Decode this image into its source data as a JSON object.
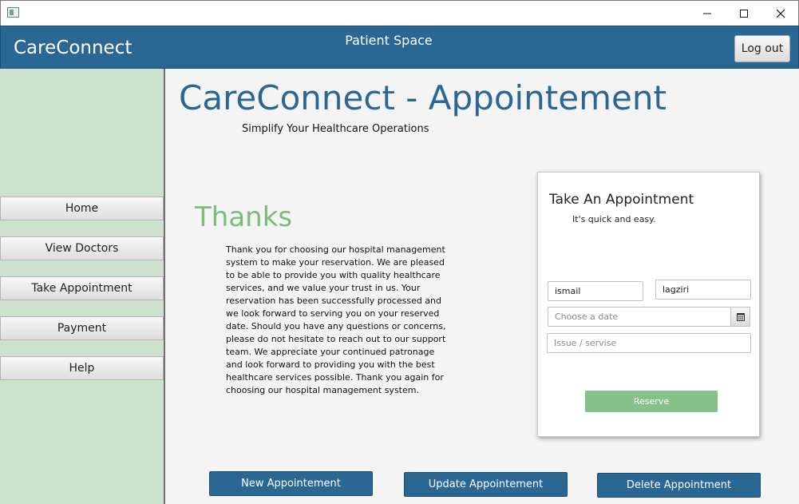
{
  "window": {
    "controls": {
      "minimize": "minimize-icon",
      "maximize": "maximize-icon",
      "close": "close-icon"
    }
  },
  "header": {
    "brand": "CareConnect",
    "space_title": "Patient Space",
    "logout_label": "Log out"
  },
  "sidebar": {
    "items": [
      {
        "label": "Home"
      },
      {
        "label": "View Doctors"
      },
      {
        "label": "Take Appointment"
      },
      {
        "label": "Payment"
      },
      {
        "label": "Help"
      }
    ]
  },
  "main": {
    "title": "CareConnect - Appointement",
    "subtitle": "Simplify Your Healthcare Operations",
    "thanks_heading": "Thanks",
    "thanks_body": "Thank you for choosing our hospital management system to make your reservation. We are pleased to be able to provide you with quality healthcare services, and we value your trust in us. Your reservation has been successfully processed and we look forward to serving you on your reserved date. Should you have any questions or concerns, please do not hesitate to reach out to our support team. We appreciate your continued patronage and look forward to providing you with the best healthcare services possible. Thank you again for choosing our hospital management system."
  },
  "form": {
    "title": "Take An Appointment",
    "subtitle": "It's quick and easy.",
    "first_name": "ismail",
    "last_name": "lagziri",
    "date_placeholder": "Choose a date",
    "issue_placeholder": "Issue / servise",
    "reserve_label": "Reserve"
  },
  "actions": {
    "new_label": "New Appointement",
    "update_label": "Update Appointement",
    "delete_label": "Delete Appointment"
  },
  "colors": {
    "primary": "#2b6793",
    "sidebar": "#cde2cc",
    "accent_green": "#86c08a",
    "thanks_green": "#7dbb7d"
  }
}
